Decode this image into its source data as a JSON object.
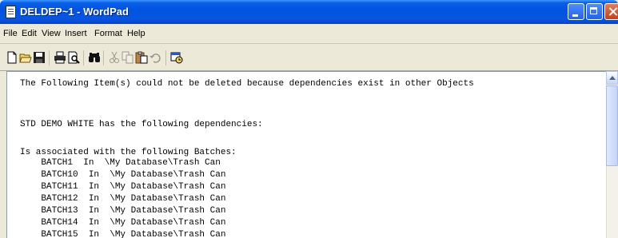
{
  "window": {
    "title": "DELDEP~1 - WordPad"
  },
  "menu": [
    "File",
    "Edit",
    "View",
    "Insert",
    "Format",
    "Help"
  ],
  "toolbar": {
    "icons": [
      "new-document-icon",
      "open-folder-icon",
      "save-icon",
      "print-icon",
      "print-preview-icon",
      "find-icon",
      "cut-icon",
      "copy-icon",
      "paste-icon",
      "undo-icon",
      "insert-datetime-icon"
    ]
  },
  "document": {
    "lines": [
      "The Following Item(s) could not be deleted because dependencies exist in other Objects",
      "",
      "",
      "STD DEMO WHITE has the following dependencies:",
      "",
      "Is associated with the following Batches:",
      "    BATCH1  In  \\My Database\\Trash Can",
      "    BATCH10  In  \\My Database\\Trash Can",
      "    BATCH11  In  \\My Database\\Trash Can",
      "    BATCH12  In  \\My Database\\Trash Can",
      "    BATCH13  In  \\My Database\\Trash Can",
      "    BATCH14  In  \\My Database\\Trash Can",
      "    BATCH15  In  \\My Database\\Trash Can"
    ]
  }
}
